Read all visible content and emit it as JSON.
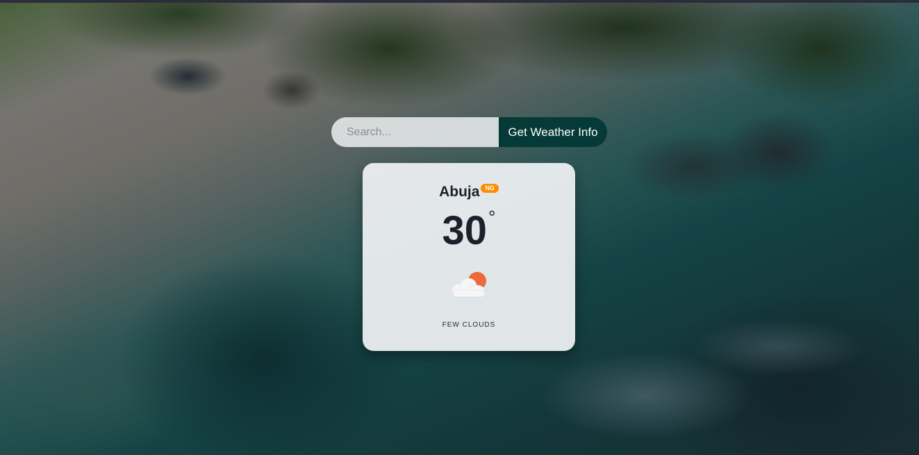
{
  "search": {
    "placeholder": "Search...",
    "value": "",
    "button_label": "Get Weather Info"
  },
  "weather": {
    "city": "Abuja",
    "country_code": "NG",
    "temperature": "30",
    "unit_symbol": "°",
    "description": "FEW CLOUDS",
    "icon": "few-clouds-icon"
  },
  "colors": {
    "button_bg": "#063a36",
    "badge_bg": "#ff8c00",
    "sun": "#ee6a3c",
    "text_dark": "#1e1f2a"
  }
}
